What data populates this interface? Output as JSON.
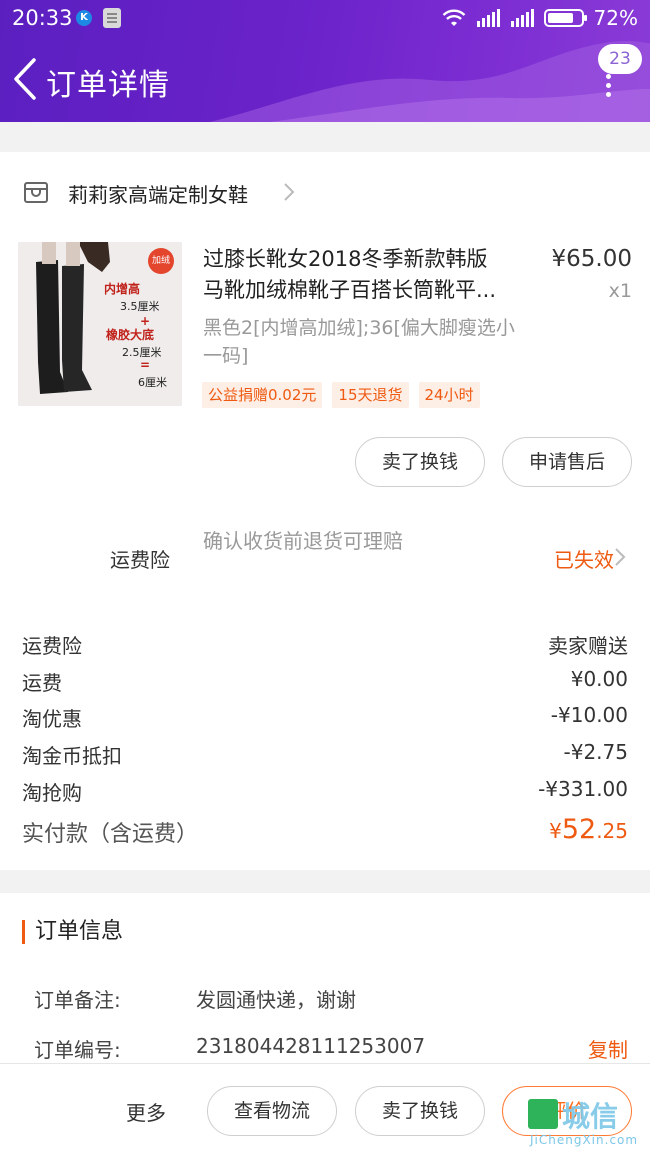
{
  "status_bar": {
    "time": "20:33",
    "battery": "72%",
    "battery_level": 0.72
  },
  "nav": {
    "title": "订单详情",
    "badge_count": "23"
  },
  "shop": {
    "name": "莉莉家高端定制女鞋"
  },
  "product": {
    "thumb_texts": [
      "加绒",
      "内增高",
      "3.5厘米",
      "+",
      "橡胶大底",
      "2.5厘米",
      "=",
      "6厘米"
    ],
    "title_line1": "过膝长靴女2018冬季新款韩版",
    "title_line2": "马靴加绒棉靴子百搭长筒靴平...",
    "price": "¥65.00",
    "qty": "x1",
    "sku": "黑色2[内增高加绒];36[偏大脚瘦选小一码]",
    "tags": [
      "公益捐赠0.02元",
      "15天退货",
      "24小时"
    ]
  },
  "item_actions": {
    "sell_label": "卖了换钱",
    "aftersale_label": "申请售后"
  },
  "insurance": {
    "label": "运费险",
    "desc": "确认收货前退货可理赔",
    "status": "已失效"
  },
  "fees": [
    {
      "label": "运费险",
      "value": "卖家赠送"
    },
    {
      "label": "运费",
      "value": "¥0.00"
    },
    {
      "label": "淘优惠",
      "value": "-¥10.00"
    },
    {
      "label": "淘金币抵扣",
      "value": "-¥2.75"
    },
    {
      "label": "淘抢购",
      "value": "-¥331.00"
    }
  ],
  "total": {
    "label": "实付款（含运费）",
    "currency": "¥",
    "int": "52",
    "dec": ".25"
  },
  "order_info": {
    "title": "订单信息",
    "note_label": "订单备注:",
    "note_value": "发圆通快递，谢谢",
    "no_label": "订单编号:",
    "no_value": "231804428111253007",
    "copy_label": "复制"
  },
  "bottom": {
    "more": "更多",
    "logistics": "查看物流",
    "sell": "卖了换钱",
    "review": "评价"
  },
  "watermark": {
    "cn": "城信",
    "en": "JiChengXin.com"
  },
  "colors": {
    "accent": "#ee5a11",
    "header_start": "#5b1fc0",
    "header_end": "#8a3bd6"
  }
}
